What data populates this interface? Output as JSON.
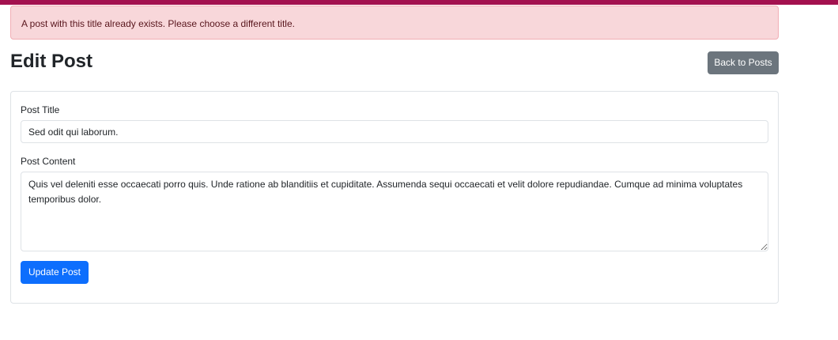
{
  "alert": {
    "message": "A post with this title already exists. Please choose a different title."
  },
  "header": {
    "title": "Edit Post",
    "back_label": "Back to Posts"
  },
  "form": {
    "title_label": "Post Title",
    "title_value": "Sed odit qui laborum.",
    "content_label": "Post Content",
    "content_value": "Quis vel deleniti esse occaecati porro quis. Unde ratione ab blanditiis et cupiditate. Assumenda sequi occaecati et velit dolore repudiandae. Cumque ad minima voluptates temporibus dolor.",
    "submit_label": "Update Post"
  },
  "colors": {
    "top_bar": "#a3114f",
    "alert_bg": "#f8d7da",
    "alert_text": "#58151c",
    "secondary_button": "#6c757d",
    "primary_button": "#0d6efd"
  }
}
